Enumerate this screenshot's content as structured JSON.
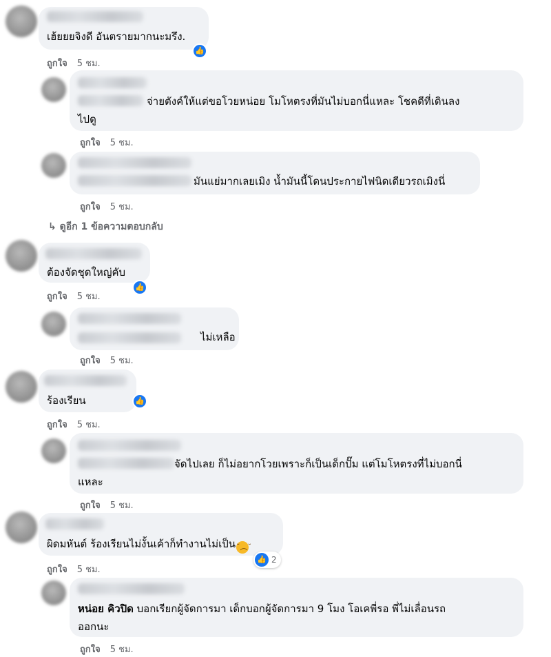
{
  "comments": [
    {
      "text": "เฮ้ยยยจิงดี อันตรายมากนะมรึง.",
      "like": "ถูกใจ",
      "time": "5 ชม."
    },
    {
      "text_line1": "จ่ายตังค์ให้แต่ขอโวยหน่อย โมโหตรงที่มันไม่บอกนี่แหละ โชคดีที่เดินลง",
      "text_line2": "ไปดู",
      "like": "ถูกใจ",
      "time": "5 ชม."
    },
    {
      "text": "มันแย่มากเลยเมิง น้ำมันนี้โดนประกายไฟนิดเดียวรถเมิงนี่",
      "like": "ถูกใจ",
      "time": "5 ชม."
    },
    {
      "text": "ต้องจัดชุดใหญ่คับ",
      "like": "ถูกใจ",
      "time": "5 ชม."
    },
    {
      "text": "ไม่เหลือ",
      "like": "ถูกใจ",
      "time": "5 ชม."
    },
    {
      "text": "ร้องเรียน",
      "like": "ถูกใจ",
      "time": "5 ชม."
    },
    {
      "text_line1": "จัดไปเลย ก็ไม่อยากโวยเพราะก็เป็นเด็กปั๊ม แต่โมโหตรงที่ไม่บอกนี่",
      "text_line2": "แหละ",
      "like": "ถูกใจ",
      "time": "5 ชม."
    },
    {
      "text": "ผิดมหันต์ ร้องเรียนไม่งั้นเค้าก็ทำงานไม่เป็น",
      "like": "ถูกใจ",
      "time": "5 ชม.",
      "reaction_count": "2"
    },
    {
      "mention": "หน่อย คิวปิด",
      "text_line1": " บอกเรียกผู้จัดการมา เด็กบอกผู้จัดการมา 9 โมง โอเคพี่รอ พี่ไม่เลื่อนรถ",
      "text_line2": "ออกนะ",
      "like": "ถูกใจ",
      "time": "5 ชม."
    }
  ],
  "view_more_replies": "ดูอีก 1 ข้อความตอบกลับ",
  "view_more_arrow": "↳",
  "icons": {
    "like": "like-reaction-icon",
    "emoji": "sad-face-icon"
  },
  "colors": {
    "bubble": "#f0f2f5",
    "meta": "#65676b",
    "like_blue": "#1877f2"
  }
}
